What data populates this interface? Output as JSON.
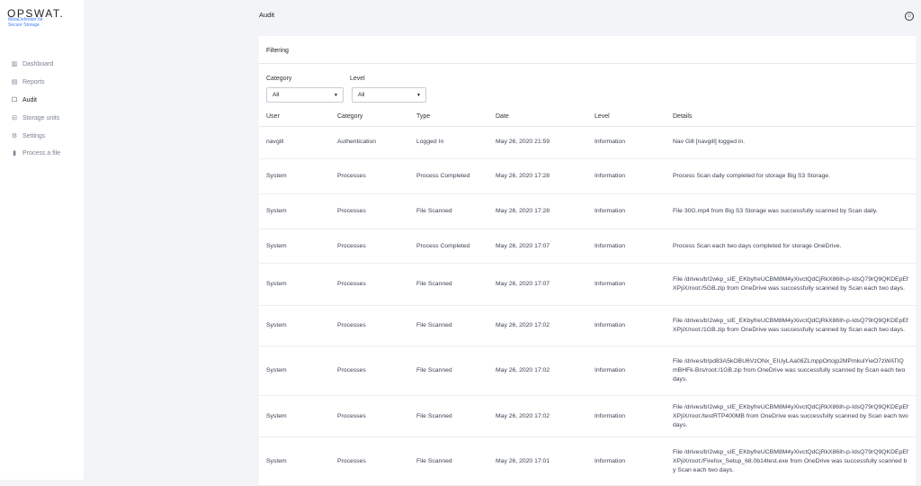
{
  "sidebar": {
    "logo": "OPSWAT.",
    "subtitle_1": "MetaDefender for",
    "subtitle_2": "Secure Storage",
    "items": [
      {
        "label": "Dashboard",
        "icon": "chart-icon"
      },
      {
        "label": "Reports",
        "icon": "report-icon"
      },
      {
        "label": "Audit",
        "icon": "calendar-icon"
      },
      {
        "label": "Storage units",
        "icon": "storage-icon"
      },
      {
        "label": "Settings",
        "icon": "gear-icon"
      },
      {
        "label": "Process a file",
        "icon": "file-icon"
      }
    ]
  },
  "header": {
    "title": "Audit"
  },
  "filtering": {
    "title": "Filtering",
    "category_label": "Category",
    "category_value": "All",
    "level_label": "Level",
    "level_value": "All"
  },
  "table": {
    "columns": [
      "User",
      "Category",
      "Type",
      "Date",
      "Level",
      "Details"
    ],
    "rows": [
      [
        "navgill",
        "Authentication",
        "Logged In",
        "May 26, 2020 21:59",
        "Information",
        "Nav Gill [navgill] logged in."
      ],
      [
        "System",
        "Processes",
        "Process Completed",
        "May 26, 2020 17:28",
        "Information",
        "Process Scan daily completed for storage Big S3 Storage."
      ],
      [
        "System",
        "Processes",
        "File Scanned",
        "May 26, 2020 17:28",
        "Information",
        "File 30G.mp4 from Big S3 Storage was successfully scanned by Scan daily."
      ],
      [
        "System",
        "Processes",
        "Process Completed",
        "May 26, 2020 17:07",
        "Information",
        "Process Scan each two days completed for storage OneDrive."
      ],
      [
        "System",
        "Processes",
        "File Scanned",
        "May 26, 2020 17:07",
        "Information",
        "File /drives/b!2wkp_sIE_EKbyfreUCBM8M4yXivctQdCjRkX86Ih-p-IdsQ79rQ9QKDEpEfXPjiX/root:/5GB.zip from OneDrive was successfully scanned by Scan each two days."
      ],
      [
        "System",
        "Processes",
        "File Scanned",
        "May 26, 2020 17:02",
        "Information",
        "File /drives/b!2wkp_sIE_EKbyfreUCBM8M4yXivctQdCjRkX86Ih-p-IdsQ79rQ9QKDEpEfXPjiX/root:/1GB.zip from OneDrive was successfully scanned by Scan each two days."
      ],
      [
        "System",
        "Processes",
        "File Scanned",
        "May 26, 2020 17:02",
        "Information",
        "File /drives/b!pd83A5kOBU6VzONx_EIUyLAa08ZLmppOrtojp2MPmkulYieO7zWATlQmBHFk-Brs/root:/1GB.zip from OneDrive was successfully scanned by Scan each two days."
      ],
      [
        "System",
        "Processes",
        "File Scanned",
        "May 26, 2020 17:02",
        "Information",
        "File /drives/b!2wkp_sIE_EKbyfreUCBM8M4yXivctQdCjRkX86Ih-p-IdsQ79rQ9QKDEpEfXPjiX/root:/testRTP400MB from OneDrive was successfully scanned by Scan each two days."
      ],
      [
        "System",
        "Processes",
        "File Scanned",
        "May 26, 2020 17:01",
        "Information",
        "File /drives/b!2wkp_sIE_EKbyfreUCBM8M4yXivctQdCjRkX86Ih-p-IdsQ79rQ9QKDEpEfXPjiX/root:/Firefox_Setup_68.0b14test.exe from OneDrive was successfully scanned by Scan each two days."
      ]
    ]
  }
}
